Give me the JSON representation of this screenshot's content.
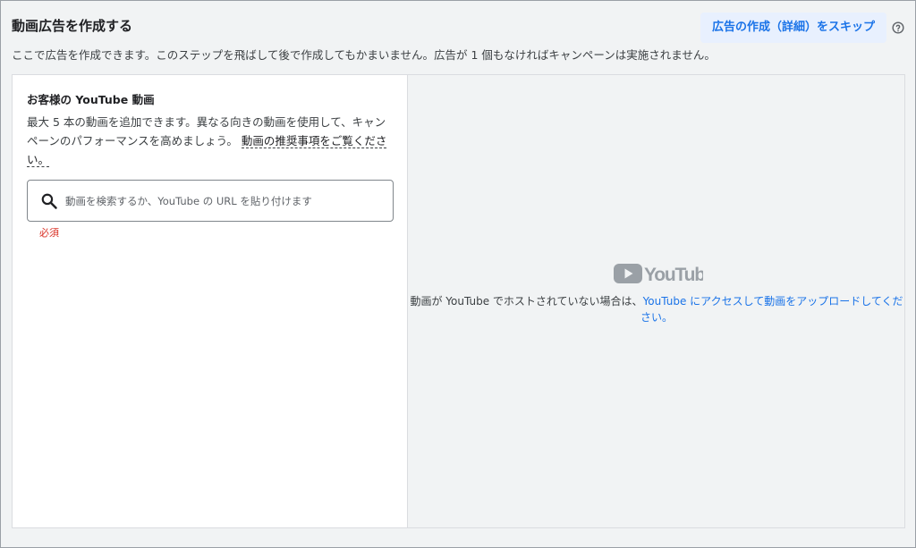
{
  "header": {
    "title": "動画広告を作成する",
    "skip_button": "広告の作成（詳細）をスキップ",
    "description": "ここで広告を作成できます。このステップを飛ばして後で作成してもかまいません。広告が 1 個もなければキャンペーンは実施されません。"
  },
  "left": {
    "title": "お客様の YouTube 動画",
    "desc_part1": "最大 5 本の動画を追加できます。異なる向きの動画を使用して、キャンペーンのパフォーマンスを高めましょう。",
    "desc_link": "動画の推奨事項をご覧ください。",
    "search_placeholder": "動画を検索するか、YouTube の URL を貼り付けます",
    "required_label": "必須"
  },
  "right": {
    "logo_text": "YouTube",
    "text_part1": "動画が YouTube でホストされていない場合は、",
    "text_link": "YouTube にアクセスして動画をアップロードしてください。"
  },
  "colors": {
    "accent": "#1a73e8",
    "error": "#d93025",
    "background": "#f1f3f4"
  },
  "icons": {
    "help": "help-circle-icon",
    "search": "search-icon",
    "logo": "youtube-logo"
  }
}
